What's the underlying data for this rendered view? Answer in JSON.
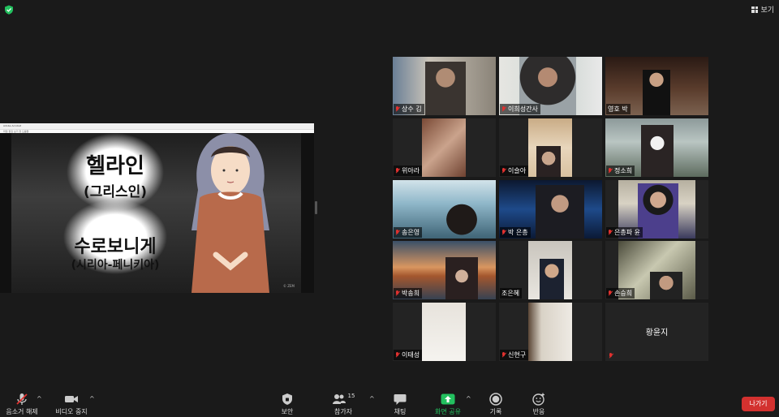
{
  "top": {
    "view_label": "보기"
  },
  "share": {
    "window_title": "Adobe Acrobat",
    "menu": "파일  편집  보기  창  도움말",
    "slide": {
      "line1": "헬라인",
      "line2": "(그리스인)",
      "line3": "수로보니게",
      "line4": "(시리아-페니키아)",
      "watermark": "© ZEM"
    }
  },
  "participants": [
    {
      "name": "상수 김",
      "muted": true
    },
    {
      "name": "이희성간사",
      "muted": true
    },
    {
      "name": "영호 박",
      "muted": false,
      "active": true
    },
    {
      "name": "위아라",
      "muted": true
    },
    {
      "name": "이슬아",
      "muted": true
    },
    {
      "name": "정소희",
      "muted": true
    },
    {
      "name": "송은영",
      "muted": true
    },
    {
      "name": "박 은총",
      "muted": true
    },
    {
      "name": "은총파 윤",
      "muted": true
    },
    {
      "name": "박송희",
      "muted": true
    },
    {
      "name": "조은혜",
      "muted": false
    },
    {
      "name": "손승희",
      "muted": true
    },
    {
      "name": "이태성",
      "muted": true
    },
    {
      "name": "신현구",
      "muted": true
    },
    {
      "name": "황윤지",
      "muted": true
    }
  ],
  "toolbar": {
    "unmute": "음소거 해제",
    "stop_video": "비디오 중지",
    "security": "보안",
    "participants": "참가자",
    "participants_count": "15",
    "chat": "채팅",
    "share_screen": "화면 공유",
    "record": "기록",
    "reactions": "반응",
    "leave": "나가기"
  },
  "colors": {
    "share_green": "#23c15f",
    "leave_red": "#d3312f",
    "active_border": "#c6d84a",
    "muted_red": "#e0312f"
  }
}
